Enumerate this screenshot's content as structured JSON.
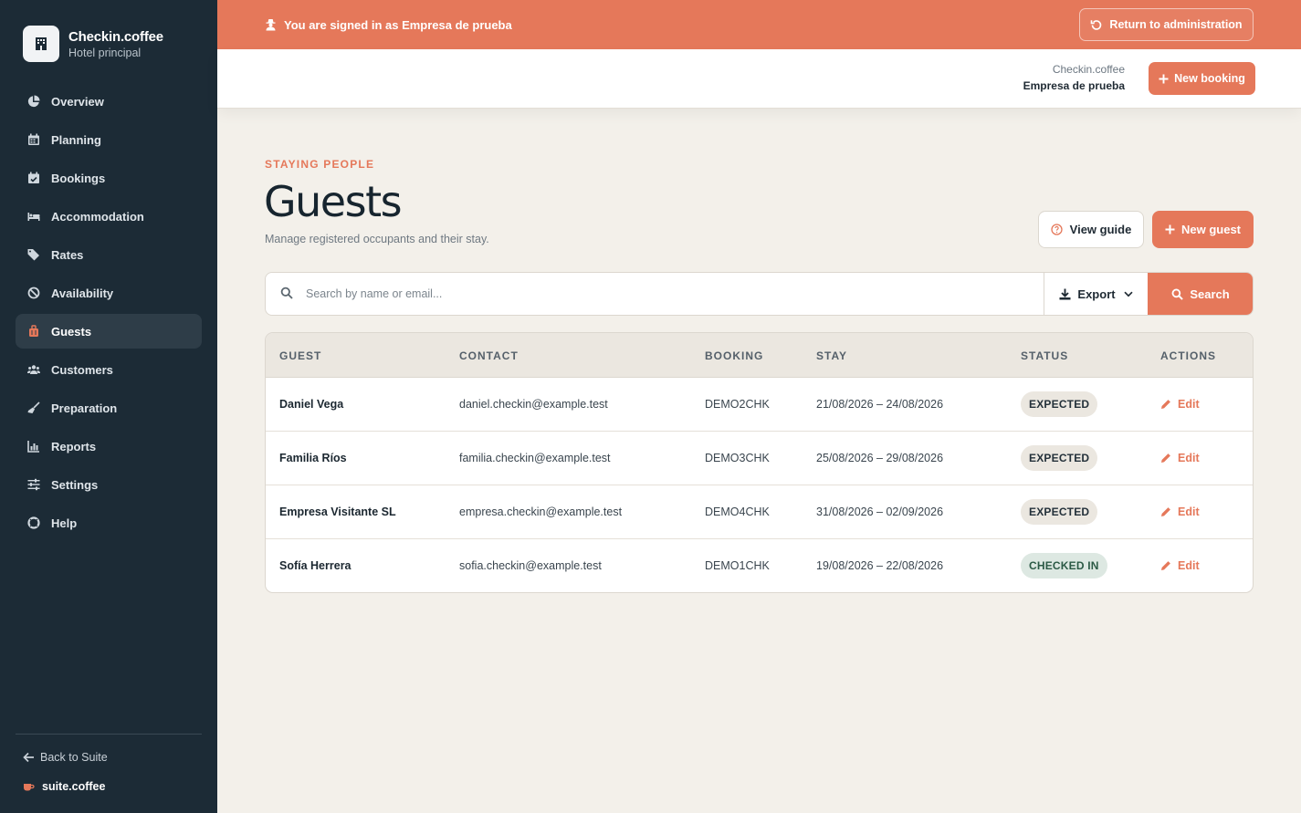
{
  "brand": {
    "name": "Checkin.coffee",
    "subtitle": "Hotel principal"
  },
  "sidebar": {
    "items": [
      {
        "label": "Overview",
        "icon": "pie-chart-icon"
      },
      {
        "label": "Planning",
        "icon": "calendar-icon"
      },
      {
        "label": "Bookings",
        "icon": "calendar-check-icon"
      },
      {
        "label": "Accommodation",
        "icon": "bed-icon"
      },
      {
        "label": "Rates",
        "icon": "tags-icon"
      },
      {
        "label": "Availability",
        "icon": "ban-icon"
      },
      {
        "label": "Guests",
        "icon": "suitcase-icon",
        "active": true
      },
      {
        "label": "Customers",
        "icon": "users-icon"
      },
      {
        "label": "Preparation",
        "icon": "broom-icon"
      },
      {
        "label": "Reports",
        "icon": "bar-chart-icon"
      },
      {
        "label": "Settings",
        "icon": "sliders-icon"
      },
      {
        "label": "Help",
        "icon": "lifebuoy-icon"
      }
    ],
    "back_label": "Back to Suite",
    "suite_label": "suite.coffee"
  },
  "banner": {
    "text": "You are signed in as Empresa de prueba",
    "return_label": "Return to administration"
  },
  "header": {
    "org": "Checkin.coffee",
    "company": "Empresa de prueba",
    "new_booking_label": "New booking"
  },
  "page": {
    "eyebrow": "STAYING PEOPLE",
    "title": "Guests",
    "description": "Manage registered occupants and their stay.",
    "view_guide_label": "View guide",
    "new_guest_label": "New guest"
  },
  "search": {
    "placeholder": "Search by name or email...",
    "export_label": "Export",
    "search_label": "Search"
  },
  "table": {
    "headers": {
      "guest": "GUEST",
      "contact": "CONTACT",
      "booking": "BOOKING",
      "stay": "STAY",
      "status": "STATUS",
      "actions": "ACTIONS"
    },
    "rows": [
      {
        "guest": "Daniel Vega",
        "contact": "daniel.checkin@example.test",
        "booking": "DEMO2CHK",
        "stay": "21/08/2026 – 24/08/2026",
        "status": "EXPECTED",
        "action": "Edit"
      },
      {
        "guest": "Familia Ríos",
        "contact": "familia.checkin@example.test",
        "booking": "DEMO3CHK",
        "stay": "25/08/2026 – 29/08/2026",
        "status": "EXPECTED",
        "action": "Edit"
      },
      {
        "guest": "Empresa Visitante SL",
        "contact": "empresa.checkin@example.test",
        "booking": "DEMO4CHK",
        "stay": "31/08/2026 – 02/09/2026",
        "status": "EXPECTED",
        "action": "Edit"
      },
      {
        "guest": "Sofía Herrera",
        "contact": "sofia.checkin@example.test",
        "booking": "DEMO1CHK",
        "stay": "19/08/2026 – 22/08/2026",
        "status": "CHECKED IN",
        "action": "Edit"
      }
    ]
  },
  "colors": {
    "accent": "#e5785a",
    "sidebar": "#1c2b36",
    "background": "#f3f0ea"
  }
}
